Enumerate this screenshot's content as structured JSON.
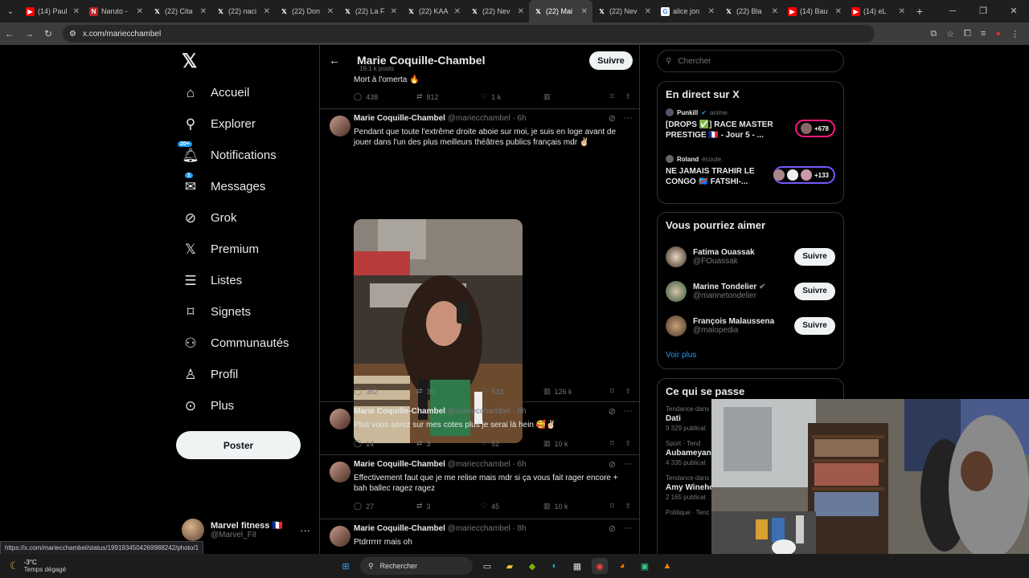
{
  "browser": {
    "tabs": [
      {
        "title": "(14) Paul",
        "icon": "youtube-icon"
      },
      {
        "title": "Naruto -",
        "icon": "naruto-icon"
      },
      {
        "title": "(22) Cita",
        "icon": "x-icon"
      },
      {
        "title": "(22) naci",
        "icon": "x-icon"
      },
      {
        "title": "(22) Don",
        "icon": "x-icon"
      },
      {
        "title": "(22) La F",
        "icon": "x-icon"
      },
      {
        "title": "(22) KAA",
        "icon": "x-icon"
      },
      {
        "title": "(22) Nev",
        "icon": "x-icon"
      },
      {
        "title": "(22) Mai",
        "icon": "x-icon",
        "active": true
      },
      {
        "title": "(22) Nev",
        "icon": "x-icon"
      },
      {
        "title": "alice jon",
        "icon": "google-icon"
      },
      {
        "title": "(22) Bla",
        "icon": "x-icon"
      },
      {
        "title": "(14) Bau",
        "icon": "youtube-icon"
      },
      {
        "title": "(14) eL",
        "icon": "youtube-icon"
      }
    ],
    "url": "x.com/mariecchambel",
    "status_url": "https://x.com/mariecchambel/status/1991934504269988242/photo/1"
  },
  "sidebar": {
    "items": [
      {
        "label": "Accueil",
        "icon": "home-icon"
      },
      {
        "label": "Explorer",
        "icon": "search-icon"
      },
      {
        "label": "Notifications",
        "icon": "bell-icon",
        "badge": "20+"
      },
      {
        "label": "Messages",
        "icon": "mail-icon",
        "badge": "1"
      },
      {
        "label": "Grok",
        "icon": "grok-icon"
      },
      {
        "label": "Premium",
        "icon": "x-logo-icon"
      },
      {
        "label": "Listes",
        "icon": "list-icon"
      },
      {
        "label": "Signets",
        "icon": "bookmark-icon"
      },
      {
        "label": "Communautés",
        "icon": "communities-icon"
      },
      {
        "label": "Profil",
        "icon": "person-icon"
      },
      {
        "label": "Plus",
        "icon": "more-circle-icon"
      }
    ],
    "post_button": "Poster",
    "account": {
      "name": "Marvel fitness 🇫🇷",
      "handle": "@Marvel_Fit"
    }
  },
  "profile_header": {
    "name": "Marie Coquille-Chambel",
    "posts": "19,1 k posts",
    "follow": "Suivre"
  },
  "tweets": [
    {
      "text": "Mort à l'omerta 🔥",
      "replies": "438",
      "reposts": "812",
      "likes": "1 k",
      "views": ""
    },
    {
      "name": "Marie Coquille-Chambel",
      "handle": "@mariecchambel",
      "time": "· 6h",
      "text": "Pendant que toute l'extrême droite aboie sur moi, je suis en loge avant de jouer dans l'un des plus meilleurs théâtres publics français mdr ✌🏻",
      "replies": "362",
      "reposts": "39",
      "likes": "533",
      "views": "126 k"
    },
    {
      "name": "Marie Coquille-Chambel",
      "handle": "@mariecchambel",
      "time": "· 6h",
      "text": "Plus vous serez sur mes cotes plus je serai là hein 🥰✌🏻",
      "replies": "14",
      "reposts": "3",
      "likes": "52",
      "views": "10 k"
    },
    {
      "name": "Marie Coquille-Chambel",
      "handle": "@mariecchambel",
      "time": "· 6h",
      "text": "Effectivement faut que je me relise mais mdr si ça vous fait rager encore + bah ballec ragez ragez",
      "replies": "27",
      "reposts": "3",
      "likes": "45",
      "views": "10 k"
    },
    {
      "name": "Marie Coquille-Chambel",
      "handle": "@mariecchambel",
      "time": "· 8h",
      "text": "Ptdrrrrrr mais oh"
    }
  ],
  "right": {
    "search_placeholder": "Chercher",
    "live": {
      "title": "En direct sur X",
      "items": [
        {
          "host": "Punkill",
          "verb": "anime.",
          "title": "[DROPS ✅] RACE MASTER PRESTIGE 🇫🇷 - Jour 5 - ...",
          "count": "+678"
        },
        {
          "host": "Roland",
          "verb": "écoute.",
          "title": "NE JAMAIS TRAHIR LE CONGO 🇨🇩 FATSHI-...",
          "count": "+133"
        }
      ]
    },
    "suggestions": {
      "title": "Vous pourriez aimer",
      "items": [
        {
          "name": "Fatima Ouassak",
          "handle": "@FOuassak",
          "follow": "Suivre"
        },
        {
          "name": "Marine Tondelier",
          "handle": "@marinetondelier",
          "follow": "Suivre"
        },
        {
          "name": "François Malaussena",
          "handle": "@malopedia",
          "follow": "Suivre"
        }
      ],
      "more": "Voir plus"
    },
    "trends": {
      "title": "Ce qui se passe",
      "items": [
        {
          "category": "Tendance dans",
          "name": "Dati",
          "posts": "9 329 publicat"
        },
        {
          "category": "Sport · Tend",
          "name": "Aubameyan",
          "posts": "4 335 publicat"
        },
        {
          "category": "Tendance dans",
          "name": "Amy Wineho",
          "posts": "2 165 publicat"
        },
        {
          "category": "Politique · Tenc",
          "name": "",
          "posts": ""
        }
      ]
    }
  },
  "taskbar": {
    "temp": "-3°C",
    "weather": "Temps dégagé",
    "search": "Rechercher"
  }
}
